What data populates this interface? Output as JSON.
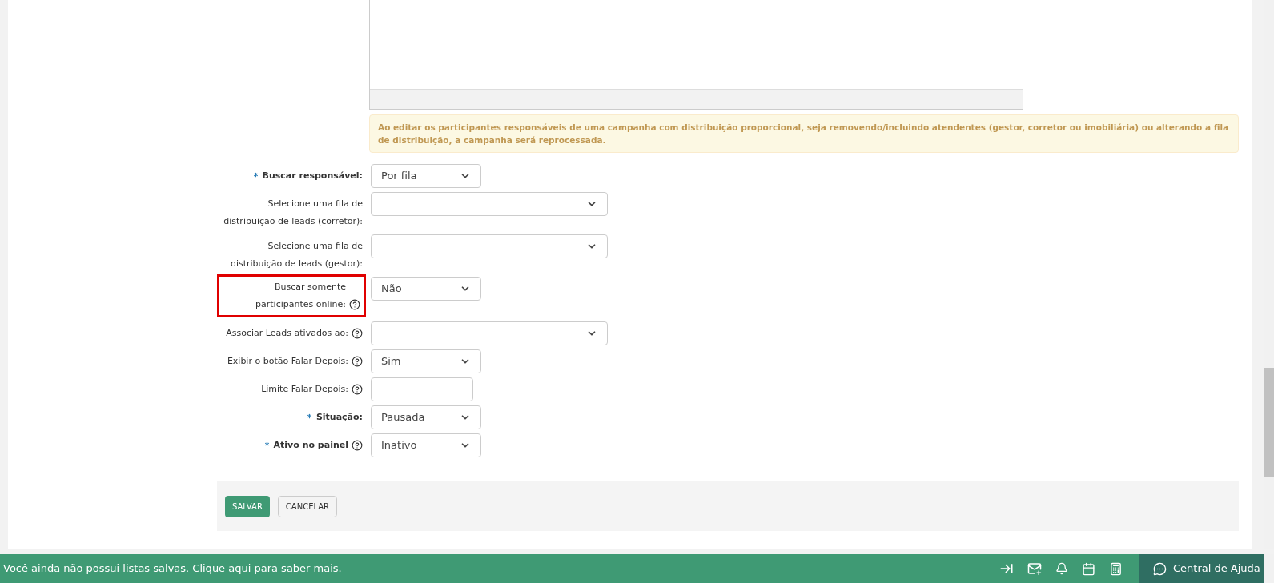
{
  "notice": "Ao editar os participantes responsáveis de uma campanha com distribuição proporcional, seja removendo/incluindo atendentes (gestor, corretor ou imobiliária) ou alterando a fila de distribuição, a campanha será reprocessada.",
  "fields": [
    {
      "label": "Buscar responsável:",
      "required": true,
      "help": false,
      "highlighted": false,
      "kind": "select",
      "value": "Por fila"
    },
    {
      "label": "Selecione uma fila de distribuição de leads (corretor):",
      "required": false,
      "help": false,
      "highlighted": false,
      "kind": "wideselect"
    },
    {
      "label": "Selecione uma fila de distribuição de leads (gestor):",
      "required": false,
      "help": false,
      "highlighted": false,
      "kind": "wideselect"
    },
    {
      "label": "Buscar somente participantes online:",
      "required": false,
      "help": true,
      "highlighted": true,
      "kind": "select",
      "value": "Não"
    },
    {
      "label": "Associar Leads ativados ao:",
      "required": false,
      "help": true,
      "highlighted": false,
      "kind": "wideselect"
    },
    {
      "label": "Exibir o botão Falar Depois:",
      "required": false,
      "help": true,
      "highlighted": false,
      "kind": "select",
      "value": "Sim"
    },
    {
      "label": "Limite Falar Depois:",
      "required": false,
      "help": true,
      "highlighted": false,
      "kind": "input"
    },
    {
      "label": "Situação:",
      "required": true,
      "help": false,
      "highlighted": false,
      "kind": "select",
      "value": "Pausada"
    },
    {
      "label": "Ativo no painel",
      "required": true,
      "help": true,
      "highlighted": false,
      "kind": "select",
      "value": "Inativo"
    }
  ],
  "buttons": [
    {
      "label": "SALVAR",
      "kind": "primary"
    },
    {
      "label": "CANCELAR",
      "kind": "secondary"
    }
  ],
  "bottom_bar": {
    "message": "Você ainda não possui listas salvas. Clique aqui para saber mais.",
    "help": "Central de Ajuda"
  }
}
